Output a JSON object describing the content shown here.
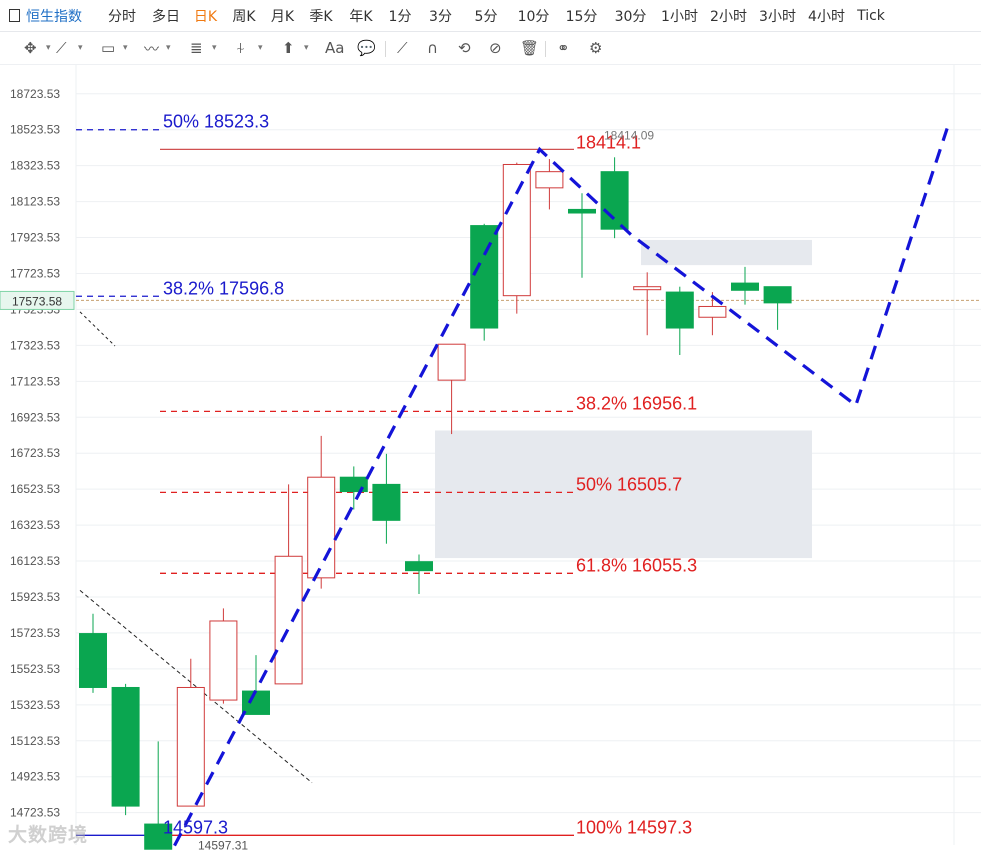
{
  "tabs": [
    {
      "label": "恒生指数",
      "active": true
    },
    {
      "label": "分时"
    },
    {
      "label": "多日"
    },
    {
      "label": "日K",
      "selected": true
    },
    {
      "label": "周K"
    },
    {
      "label": "月K"
    },
    {
      "label": "季K"
    },
    {
      "label": "年K"
    },
    {
      "label": "1分"
    },
    {
      "label": "3分"
    },
    {
      "label": "5分"
    },
    {
      "label": "10分"
    },
    {
      "label": "15分"
    },
    {
      "label": "30分"
    },
    {
      "label": "1小时"
    },
    {
      "label": "2小时"
    },
    {
      "label": "3小时"
    },
    {
      "label": "4小时"
    },
    {
      "label": "Tick"
    }
  ],
  "tabs_colors": {
    "active": "#1f6fc5",
    "selected": "#f07a12",
    "normal": "#333333"
  },
  "toolbar": {
    "icons": [
      "move-icon",
      "line-tool-icon",
      "rect-tool-icon",
      "path-tool-icon",
      "fib-tool-icon",
      "measure-tool-icon",
      "arrow-tool-icon",
      "text-tool-icon",
      "comment-tool-icon",
      "pen-icon",
      "magnet-icon",
      "lock-icon",
      "eye-off-icon",
      "trash-icon",
      "link-icon",
      "settings-icon"
    ],
    "text_label": "Aa"
  },
  "watermark": "大数跨境",
  "chart_data": {
    "type": "candlestick",
    "y_ticks": [
      "18723.53",
      "18523.53",
      "18323.53",
      "18123.53",
      "17923.53",
      "17723.53",
      "17523.53",
      "17323.53",
      "17123.53",
      "16923.53",
      "16723.53",
      "16523.53",
      "16323.53",
      "16123.53",
      "15923.53",
      "15723.53",
      "15523.53",
      "15323.53",
      "15123.53",
      "14923.53",
      "14723.53"
    ],
    "y_range": [
      14543.53,
      18883.53
    ],
    "last_price_label": "17573.58",
    "last_price": 17573.58,
    "colors": {
      "up": "#d03a3a",
      "down": "#0aa650",
      "fib_red": "#e02020",
      "fib_blue": "#1a1acc",
      "zone": "#e6e9ee",
      "price_line": "#c8a070"
    },
    "candles": [
      {
        "o": 15720,
        "h": 15830,
        "l": 15390,
        "c": 15420
      },
      {
        "o": 15420,
        "h": 15440,
        "l": 14710,
        "c": 14760
      },
      {
        "o": 14660,
        "h": 15120,
        "l": 14540,
        "c": 14520
      },
      {
        "o": 14760,
        "h": 15580,
        "l": 14760,
        "c": 15420
      },
      {
        "o": 15350,
        "h": 15860,
        "l": 15330,
        "c": 15790
      },
      {
        "o": 15400,
        "h": 15600,
        "l": 15300,
        "c": 15270
      },
      {
        "o": 15440,
        "h": 16550,
        "l": 15440,
        "c": 16150
      },
      {
        "o": 16030,
        "h": 16820,
        "l": 15970,
        "c": 16590
      },
      {
        "o": 16590,
        "h": 16650,
        "l": 16410,
        "c": 16510
      },
      {
        "o": 16550,
        "h": 16720,
        "l": 16220,
        "c": 16350
      },
      {
        "o": 16120,
        "h": 16160,
        "l": 15940,
        "c": 16070
      },
      {
        "o": 17130,
        "h": 17330,
        "l": 16830,
        "c": 17330
      },
      {
        "o": 17990,
        "h": 18000,
        "l": 17350,
        "c": 17420
      },
      {
        "o": 17600,
        "h": 18340,
        "l": 17500,
        "c": 18330
      },
      {
        "o": 18200,
        "h": 18360,
        "l": 18080,
        "c": 18290
      },
      {
        "o": 18080,
        "h": 18170,
        "l": 17700,
        "c": 18060
      },
      {
        "o": 18290,
        "h": 18370,
        "l": 17920,
        "c": 17970
      },
      {
        "o": 17640,
        "h": 17730,
        "l": 17380,
        "c": 17650
      },
      {
        "o": 17620,
        "h": 17650,
        "l": 17270,
        "c": 17420
      },
      {
        "o": 17480,
        "h": 17620,
        "l": 17380,
        "c": 17540
      },
      {
        "o": 17670,
        "h": 17760,
        "l": 17550,
        "c": 17630
      },
      {
        "o": 17650,
        "h": 17650,
        "l": 17410,
        "c": 17560
      }
    ],
    "fib_levels": [
      {
        "label": "50% 18523.3",
        "value": 18523.3,
        "color": "blue"
      },
      {
        "label": "38.2% 17596.8",
        "value": 17596.8,
        "color": "blue"
      },
      {
        "label": "38.2% 16956.1",
        "value": 16956.1,
        "color": "red"
      },
      {
        "label": "50% 16505.7",
        "value": 16505.7,
        "color": "red"
      },
      {
        "label": "61.8% 16055.3",
        "value": 16055.3,
        "color": "red"
      },
      {
        "label": "100% 14597.3",
        "value": 14597.3,
        "color": "red"
      }
    ],
    "peak_label": "18414.1",
    "peak_axis_label": "18414.09",
    "low_label": "14597.3",
    "low_axis_label": "14597.31",
    "zones": [
      {
        "top": 16850,
        "bottom": 16140
      },
      {
        "top": 17910,
        "bottom": 17770
      }
    ],
    "projection_path": [
      {
        "bar": 2.5,
        "y": 14540
      },
      {
        "bar": 13.7,
        "y": 18414
      },
      {
        "bar": 16.5,
        "y": 17940
      },
      {
        "bar": 23.4,
        "y": 16990
      },
      {
        "bar": 26.2,
        "y": 18530
      }
    ]
  }
}
